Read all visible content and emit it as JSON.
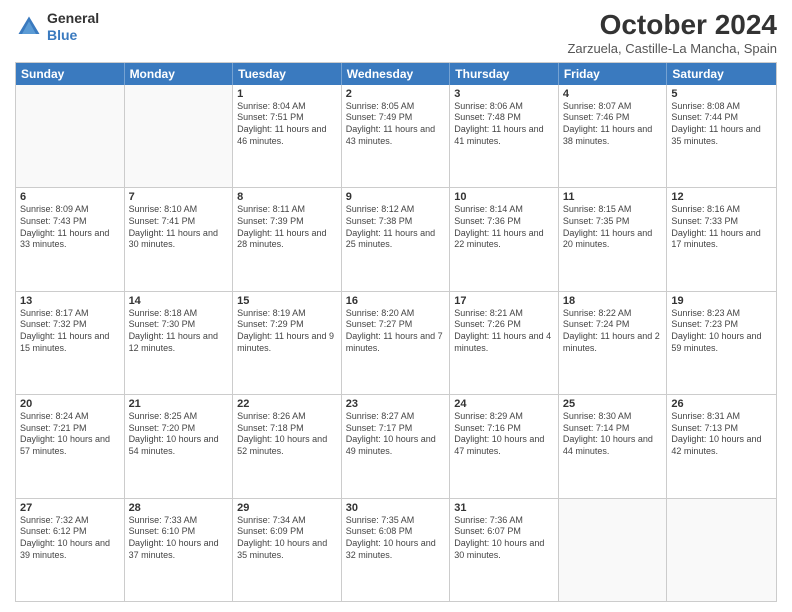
{
  "header": {
    "logo_general": "General",
    "logo_blue": "Blue",
    "month_title": "October 2024",
    "location": "Zarzuela, Castille-La Mancha, Spain"
  },
  "days_of_week": [
    "Sunday",
    "Monday",
    "Tuesday",
    "Wednesday",
    "Thursday",
    "Friday",
    "Saturday"
  ],
  "weeks": [
    [
      {
        "day": "",
        "empty": true
      },
      {
        "day": "",
        "empty": true
      },
      {
        "day": "1",
        "sunrise": "Sunrise: 8:04 AM",
        "sunset": "Sunset: 7:51 PM",
        "daylight": "Daylight: 11 hours and 46 minutes."
      },
      {
        "day": "2",
        "sunrise": "Sunrise: 8:05 AM",
        "sunset": "Sunset: 7:49 PM",
        "daylight": "Daylight: 11 hours and 43 minutes."
      },
      {
        "day": "3",
        "sunrise": "Sunrise: 8:06 AM",
        "sunset": "Sunset: 7:48 PM",
        "daylight": "Daylight: 11 hours and 41 minutes."
      },
      {
        "day": "4",
        "sunrise": "Sunrise: 8:07 AM",
        "sunset": "Sunset: 7:46 PM",
        "daylight": "Daylight: 11 hours and 38 minutes."
      },
      {
        "day": "5",
        "sunrise": "Sunrise: 8:08 AM",
        "sunset": "Sunset: 7:44 PM",
        "daylight": "Daylight: 11 hours and 35 minutes."
      }
    ],
    [
      {
        "day": "6",
        "sunrise": "Sunrise: 8:09 AM",
        "sunset": "Sunset: 7:43 PM",
        "daylight": "Daylight: 11 hours and 33 minutes."
      },
      {
        "day": "7",
        "sunrise": "Sunrise: 8:10 AM",
        "sunset": "Sunset: 7:41 PM",
        "daylight": "Daylight: 11 hours and 30 minutes."
      },
      {
        "day": "8",
        "sunrise": "Sunrise: 8:11 AM",
        "sunset": "Sunset: 7:39 PM",
        "daylight": "Daylight: 11 hours and 28 minutes."
      },
      {
        "day": "9",
        "sunrise": "Sunrise: 8:12 AM",
        "sunset": "Sunset: 7:38 PM",
        "daylight": "Daylight: 11 hours and 25 minutes."
      },
      {
        "day": "10",
        "sunrise": "Sunrise: 8:14 AM",
        "sunset": "Sunset: 7:36 PM",
        "daylight": "Daylight: 11 hours and 22 minutes."
      },
      {
        "day": "11",
        "sunrise": "Sunrise: 8:15 AM",
        "sunset": "Sunset: 7:35 PM",
        "daylight": "Daylight: 11 hours and 20 minutes."
      },
      {
        "day": "12",
        "sunrise": "Sunrise: 8:16 AM",
        "sunset": "Sunset: 7:33 PM",
        "daylight": "Daylight: 11 hours and 17 minutes."
      }
    ],
    [
      {
        "day": "13",
        "sunrise": "Sunrise: 8:17 AM",
        "sunset": "Sunset: 7:32 PM",
        "daylight": "Daylight: 11 hours and 15 minutes."
      },
      {
        "day": "14",
        "sunrise": "Sunrise: 8:18 AM",
        "sunset": "Sunset: 7:30 PM",
        "daylight": "Daylight: 11 hours and 12 minutes."
      },
      {
        "day": "15",
        "sunrise": "Sunrise: 8:19 AM",
        "sunset": "Sunset: 7:29 PM",
        "daylight": "Daylight: 11 hours and 9 minutes."
      },
      {
        "day": "16",
        "sunrise": "Sunrise: 8:20 AM",
        "sunset": "Sunset: 7:27 PM",
        "daylight": "Daylight: 11 hours and 7 minutes."
      },
      {
        "day": "17",
        "sunrise": "Sunrise: 8:21 AM",
        "sunset": "Sunset: 7:26 PM",
        "daylight": "Daylight: 11 hours and 4 minutes."
      },
      {
        "day": "18",
        "sunrise": "Sunrise: 8:22 AM",
        "sunset": "Sunset: 7:24 PM",
        "daylight": "Daylight: 11 hours and 2 minutes."
      },
      {
        "day": "19",
        "sunrise": "Sunrise: 8:23 AM",
        "sunset": "Sunset: 7:23 PM",
        "daylight": "Daylight: 10 hours and 59 minutes."
      }
    ],
    [
      {
        "day": "20",
        "sunrise": "Sunrise: 8:24 AM",
        "sunset": "Sunset: 7:21 PM",
        "daylight": "Daylight: 10 hours and 57 minutes."
      },
      {
        "day": "21",
        "sunrise": "Sunrise: 8:25 AM",
        "sunset": "Sunset: 7:20 PM",
        "daylight": "Daylight: 10 hours and 54 minutes."
      },
      {
        "day": "22",
        "sunrise": "Sunrise: 8:26 AM",
        "sunset": "Sunset: 7:18 PM",
        "daylight": "Daylight: 10 hours and 52 minutes."
      },
      {
        "day": "23",
        "sunrise": "Sunrise: 8:27 AM",
        "sunset": "Sunset: 7:17 PM",
        "daylight": "Daylight: 10 hours and 49 minutes."
      },
      {
        "day": "24",
        "sunrise": "Sunrise: 8:29 AM",
        "sunset": "Sunset: 7:16 PM",
        "daylight": "Daylight: 10 hours and 47 minutes."
      },
      {
        "day": "25",
        "sunrise": "Sunrise: 8:30 AM",
        "sunset": "Sunset: 7:14 PM",
        "daylight": "Daylight: 10 hours and 44 minutes."
      },
      {
        "day": "26",
        "sunrise": "Sunrise: 8:31 AM",
        "sunset": "Sunset: 7:13 PM",
        "daylight": "Daylight: 10 hours and 42 minutes."
      }
    ],
    [
      {
        "day": "27",
        "sunrise": "Sunrise: 7:32 AM",
        "sunset": "Sunset: 6:12 PM",
        "daylight": "Daylight: 10 hours and 39 minutes."
      },
      {
        "day": "28",
        "sunrise": "Sunrise: 7:33 AM",
        "sunset": "Sunset: 6:10 PM",
        "daylight": "Daylight: 10 hours and 37 minutes."
      },
      {
        "day": "29",
        "sunrise": "Sunrise: 7:34 AM",
        "sunset": "Sunset: 6:09 PM",
        "daylight": "Daylight: 10 hours and 35 minutes."
      },
      {
        "day": "30",
        "sunrise": "Sunrise: 7:35 AM",
        "sunset": "Sunset: 6:08 PM",
        "daylight": "Daylight: 10 hours and 32 minutes."
      },
      {
        "day": "31",
        "sunrise": "Sunrise: 7:36 AM",
        "sunset": "Sunset: 6:07 PM",
        "daylight": "Daylight: 10 hours and 30 minutes."
      },
      {
        "day": "",
        "empty": true
      },
      {
        "day": "",
        "empty": true
      }
    ]
  ]
}
